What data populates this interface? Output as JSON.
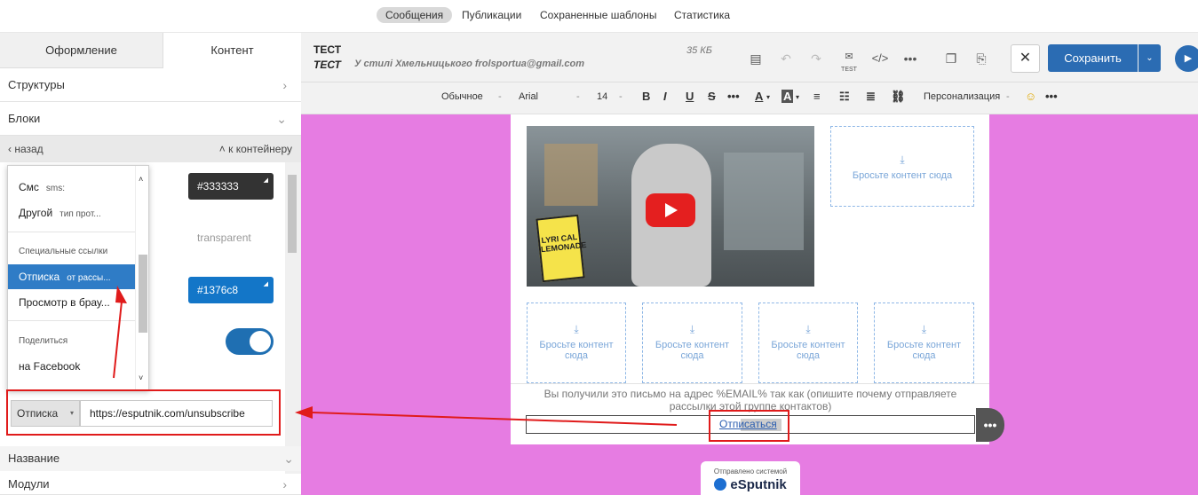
{
  "topnav": {
    "tabs": [
      "Сообщения",
      "Публикации",
      "Сохраненные шаблоны",
      "Статистика"
    ]
  },
  "leftpanel": {
    "tabs": [
      "Оформление",
      "Контент"
    ],
    "sections": {
      "structures": "Структуры",
      "blocks": "Блоки",
      "name": "Название",
      "modules": "Модули"
    },
    "back": "назад",
    "to_container": "к контейнеру",
    "colors": {
      "dark": "#333333",
      "transparent": "transparent",
      "blue": "#1376c8"
    },
    "dropdown": {
      "items_top": [
        {
          "label": "Смс",
          "hint": "sms:"
        },
        {
          "label": "Другой",
          "hint": "тип прот..."
        }
      ],
      "special_header": "Специальные ссылки",
      "items_special": [
        {
          "label": "Отписка",
          "hint": "от рассы..."
        },
        {
          "label": "Просмотр в брау...",
          "hint": ""
        }
      ],
      "share_header": "Поделиться",
      "items_share": [
        {
          "label": "на Facebook"
        }
      ]
    },
    "link_type": "Отписка",
    "link_url": "https://esputnik.com/unsubscribe"
  },
  "editor": {
    "subject": "ТЕСТ",
    "preheader": "ТЕСТ",
    "sender": "У стилі Хмельницького frolsportua@gmail.com",
    "size": "35 КБ",
    "test_label": "TEST",
    "save_label": "Сохранить",
    "toolbar": {
      "style": "Обычное",
      "font": "Arial",
      "size": "14",
      "personalization": "Персонализация"
    }
  },
  "email": {
    "dropzone_text": "Бросьте контент сюда",
    "footer_text": "Вы получили это письмо на адрес %EMAIL% так как (опишите почему отправляете рассылки этой группе контактов)",
    "unsubscribe_link": "Отписаться",
    "badge_top": "Отправлено системой",
    "badge_brand": "eSputnik",
    "video_sign": "LYRI CAL LEMONADE"
  },
  "colors": {
    "primary": "#2b6cb3",
    "canvas": "#e67ce2",
    "highlight": "#e01b1b"
  }
}
